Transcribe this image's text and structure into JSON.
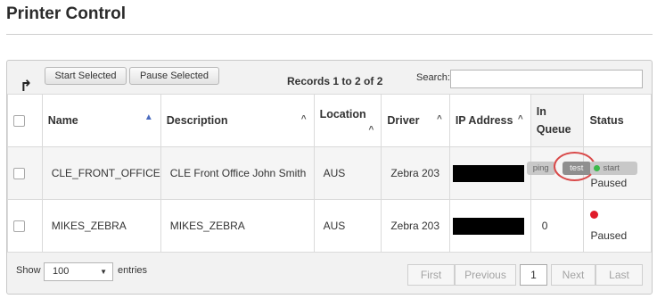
{
  "page": {
    "title": "Printer Control"
  },
  "toolbar": {
    "start_selected": "Start Selected",
    "pause_selected": "Pause Selected",
    "records_info": "Records 1 to 2 of 2",
    "search_label": "Search:",
    "search_value": ""
  },
  "table": {
    "headers": {
      "name": "Name",
      "description": "Description",
      "location": "Location",
      "driver": "Driver",
      "ip_address": "IP Address",
      "in_queue": "In Queue",
      "status": "Status"
    },
    "rows": [
      {
        "name": "CLE_FRONT_OFFICE",
        "description": "CLE Front Office John Smith",
        "location": "AUS",
        "driver": "Zebra 203",
        "in_queue": "",
        "ping_label": "ping",
        "test_label": "test",
        "start_label": "start",
        "status": "Paused"
      },
      {
        "name": "MIKES_ZEBRA",
        "description": "MIKES_ZEBRA",
        "location": "AUS",
        "driver": "Zebra 203",
        "in_queue": "0",
        "status": "Paused"
      }
    ]
  },
  "footer": {
    "show_label": "Show",
    "page_length": "100",
    "entries_label": "entries",
    "pager": {
      "first": "First",
      "previous": "Previous",
      "current": "1",
      "next": "Next",
      "last": "Last"
    }
  },
  "colors": {
    "status_paused": "#e01b2a",
    "status_running": "#3cb84a",
    "annotation": "#d94a4a"
  }
}
